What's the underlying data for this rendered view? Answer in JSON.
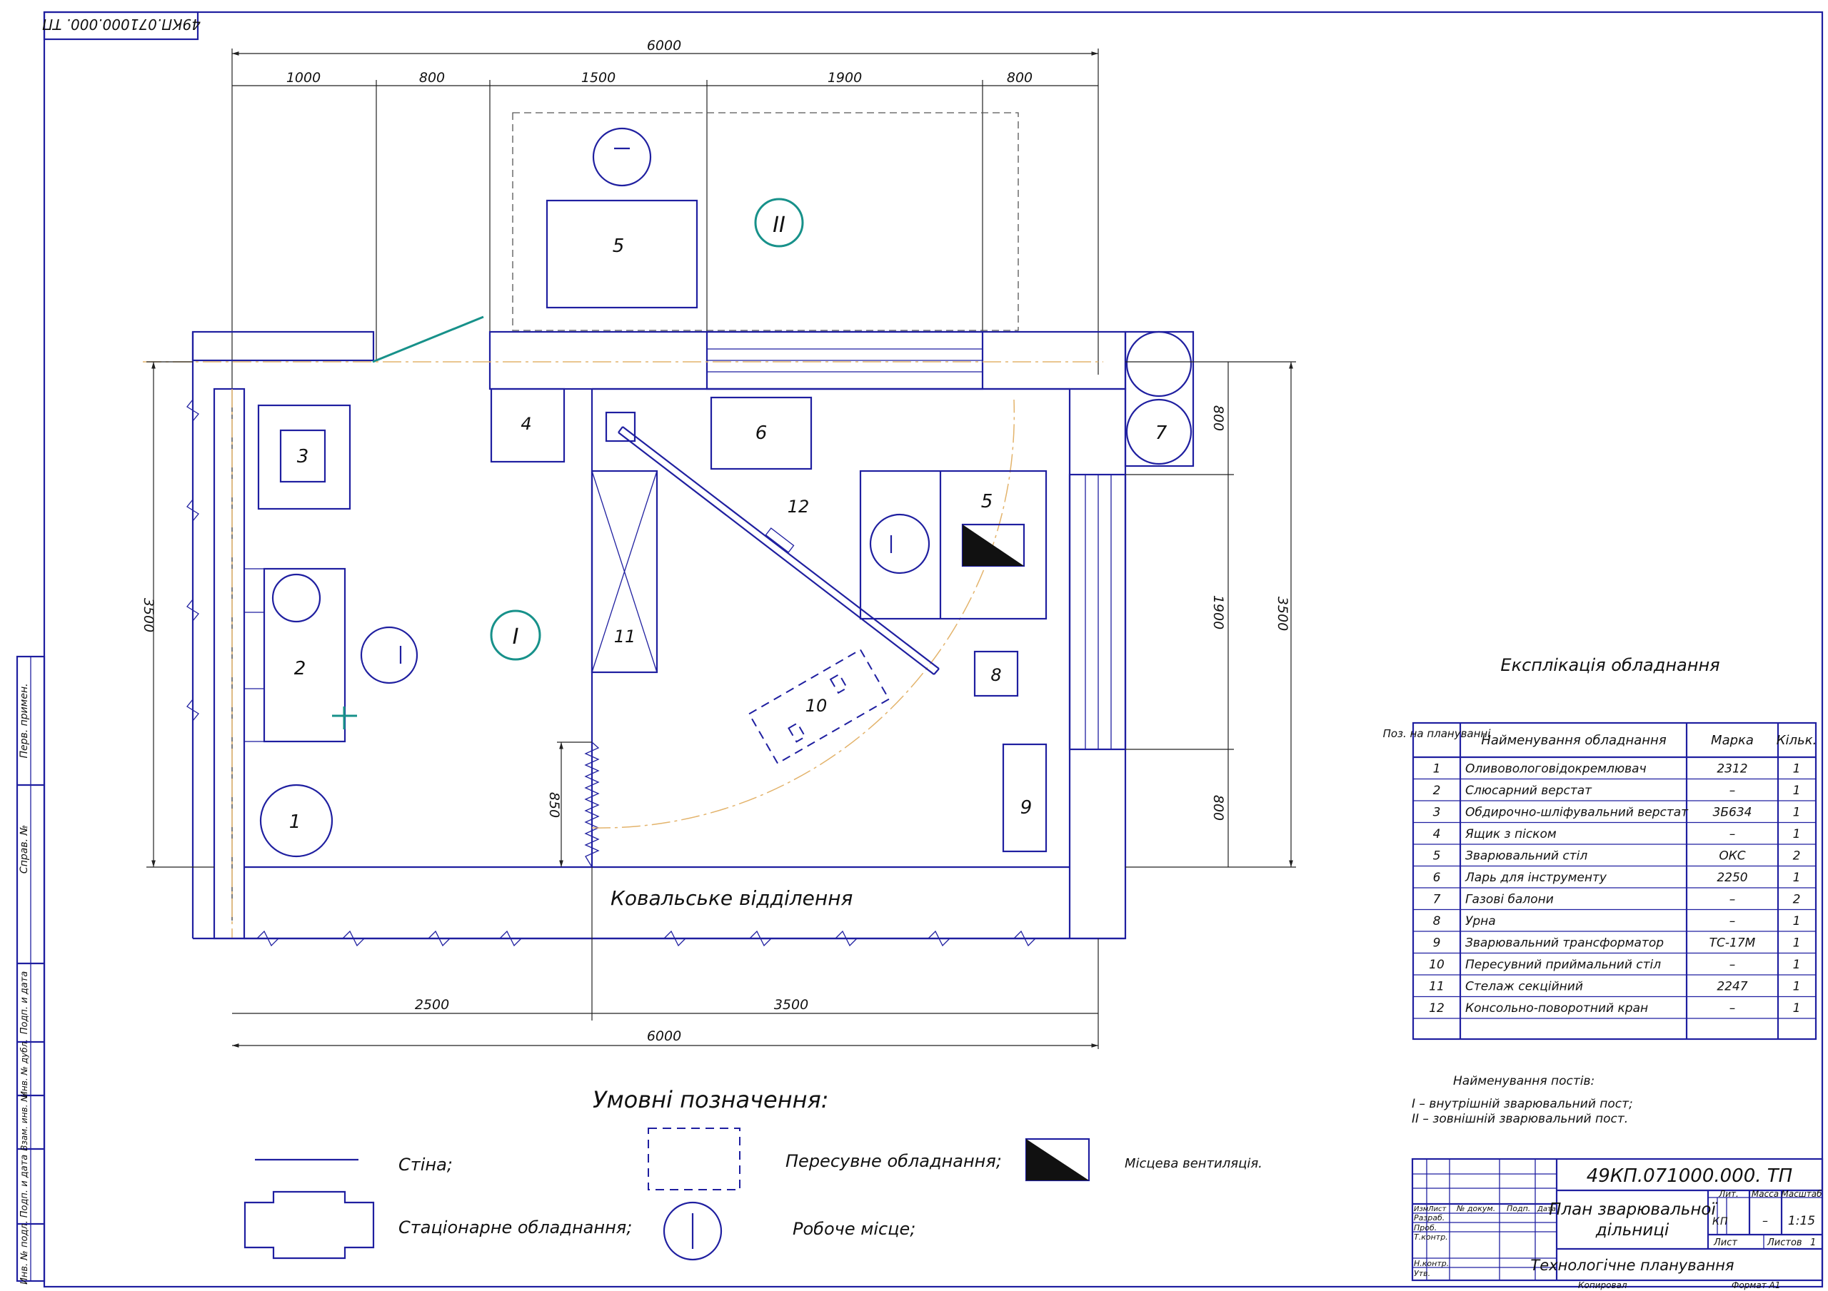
{
  "doc_code": "49КП.071000.000. ТП",
  "dims": {
    "top_total": "6000",
    "top": [
      "1000",
      "800",
      "1500",
      "1900",
      "800"
    ],
    "bottom": [
      "2500",
      "3500"
    ],
    "bottom_total": "6000",
    "left": "3500",
    "right_outer": "3500",
    "right": [
      "800",
      "1900",
      "800"
    ],
    "wall_850": "850"
  },
  "labels": {
    "n1": "1",
    "n2": "2",
    "n3": "3",
    "n4": "4",
    "n5a": "5",
    "n5b": "5",
    "n6": "6",
    "n7": "7",
    "n8": "8",
    "n9": "9",
    "n10": "10",
    "n11": "11",
    "n12": "12",
    "post1": "I",
    "post2": "II",
    "forge": "Ковальське відділення"
  },
  "legend": {
    "title": "Умовні позначення:",
    "wall": "Стіна;",
    "stationary": "Стаціонарне обладнання;",
    "mobile": "Пересувне обладнання;",
    "workplace": "Робоче місце;",
    "ventilation": "Місцева вентиляція."
  },
  "explication": {
    "title": "Експлікація обладнання",
    "headers": [
      "Поз. на плануванні",
      "Найменування обладнання",
      "Марка",
      "Кільк."
    ],
    "rows": [
      [
        "1",
        "Оливовологовідокремлювач",
        "2312",
        "1"
      ],
      [
        "2",
        "Слюсарний верстат",
        "–",
        "1"
      ],
      [
        "3",
        "Обдирочно-шліфувальний верстат",
        "3Б634",
        "1"
      ],
      [
        "4",
        "Ящик з піском",
        "–",
        "1"
      ],
      [
        "5",
        "Зварювальний стіл",
        "ОКС",
        "2"
      ],
      [
        "6",
        "Ларь для інструменту",
        "2250",
        "1"
      ],
      [
        "7",
        "Газові балони",
        "–",
        "2"
      ],
      [
        "8",
        "Урна",
        "–",
        "1"
      ],
      [
        "9",
        "Зварювальний трансформатор",
        "ТС-17М",
        "1"
      ],
      [
        "10",
        "Пересувний приймальний стіл",
        "–",
        "1"
      ],
      [
        "11",
        "Стелаж секційний",
        "2247",
        "1"
      ],
      [
        "12",
        "Консольно-поворотний кран",
        "–",
        "1"
      ]
    ]
  },
  "posts": {
    "title": "Найменування постів:",
    "p1": "I – внутрішній зварювальний пост;",
    "p2": "II – зовнішній зварювальний пост."
  },
  "title_block": {
    "code": "49КП.071000.000. ТП",
    "name_line1": "План зварювальної",
    "name_line2": "дільниці",
    "subtitle": "Технологічне планування",
    "col_izm": "Изм",
    "col_list": "Лист",
    "col_doc": "№ докум.",
    "col_podp": "Подп.",
    "col_data": "Дата",
    "razrab": "Разраб.",
    "prob": "Проб.",
    "tkontr": "Т.контр.",
    "nkontr": "Н.контр.",
    "utv": "Утв.",
    "lit": "Лит.",
    "massa": "Масса",
    "masshtab": "Масштаб",
    "lit_k": "К",
    "lit_p": "П",
    "mass_val": "–",
    "scale_val": "1:15",
    "sheet_label": "Лист",
    "sheets_label": "Листов",
    "sheets_val": "1",
    "copied": "Копировал",
    "format": "Формат   А1"
  },
  "side_stamp": {
    "s1": "Перв. примен.",
    "s2": "Справ. №",
    "s3": "Подп. и дата",
    "s4": "Инв. № дубл.",
    "s5": "Взам. инв. №",
    "s6": "Подп. и дата",
    "s7": "Инв. № подл."
  }
}
